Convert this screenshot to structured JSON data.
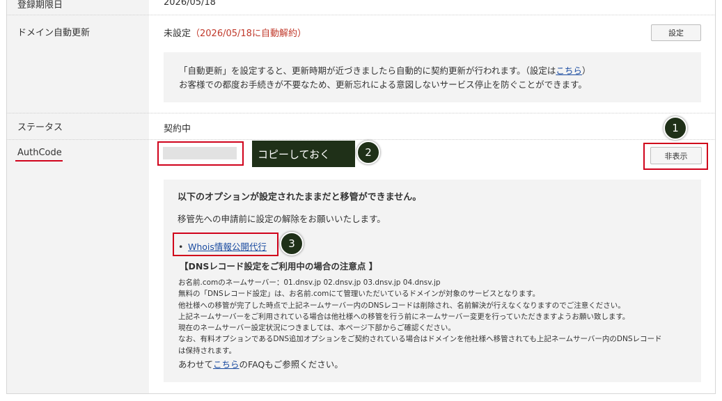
{
  "rows": {
    "expiry": {
      "label": "登録期限日",
      "value": "2026/05/18"
    },
    "auto_renew": {
      "label": "ドメイン自動更新",
      "status": "未設定",
      "status_note": "（2026/05/18に自動解約）",
      "button": "設定",
      "info_line1_before": "「自動更新」を設定すると、更新時期が近づきましたら自動的に契約更新が行われます。（設定は",
      "info_link": "こちら",
      "info_line1_after": "）",
      "info_line2": "お客様での都度お手続きが不要なため、更新忘れによる意図しないサービス停止を防ぐことができます。"
    },
    "status": {
      "label": "ステータス",
      "value": "契約中"
    },
    "authcode": {
      "label": "AuthCode",
      "hide_button": "非表示",
      "copy_note": "コピーしておく",
      "notice": {
        "heading": "以下のオプションが設定されたままだと移管ができません。",
        "subtext": "移管先への申請前に設定の解除をお願いいたします。",
        "option_link": "Whois情報公開代行",
        "dns_heading": "【DNSレコード設定をご利用中の場合の注意点 】",
        "dns_lines": [
          "お名前.comのネームサーバー：01.dnsv.jp 02.dnsv.jp 03.dnsv.jp 04.dnsv.jp",
          "無料の「DNSレコード設定」は、お名前.comにて管理いただいているドメインが対象のサービスとなります。",
          "他社様への移管が完了した時点で上記ネームサーバー内のDNSレコードは削除され、名前解決が行えなくなりますのでご注意ください。",
          "上記ネームサーバーをご利用されている場合は他社様への移管を行う前にネームサーバー変更を行っていただきますようお願い致します。",
          "現在のネームサーバー設定状況につきましては、本ページ下部からご確認ください。",
          "なお、有料オプションであるDNS追加オプションをご契約されている場合はドメインを他社様へ移管されても上記ネームサーバー内のDNSレコード",
          "は保持されます。"
        ],
        "faq_before": "あわせて",
        "faq_link": "こちら",
        "faq_after": "のFAQもご参照ください。"
      }
    }
  },
  "callouts": [
    "1",
    "2",
    "3"
  ]
}
